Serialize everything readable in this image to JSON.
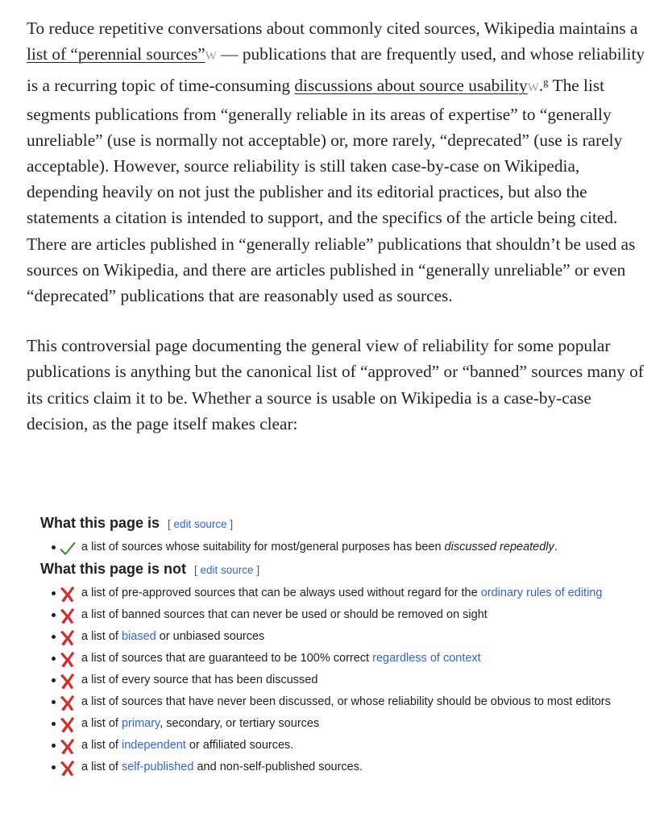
{
  "article": {
    "p1": {
      "t1": "To reduce repetitive conversations about commonly cited sources, Wikipedia maintains a ",
      "link1": "list of “perennial sources”",
      "wmark1": "W",
      "t2": " — publications that are frequently used, and whose reliability is a recurring topic of time-consuming ",
      "link2": "discussions about source usability",
      "wmark2": "W",
      "t3": ".",
      "sup": "g",
      "t4": " The list segments publications from “generally reliable in its areas of expertise” to “generally unreliable” (use is normally not acceptable) or, more rarely, “deprecated” (use is rarely acceptable). However, source reliability is still taken case-by-case on Wikipedia, depending heavily on not just the publisher and its editorial practices, but also the statements a citation is intended to support, and the specifics of the article being cited. There are articles published in “generally reliable” publications that shouldn’t be used as sources on Wikipedia, and there are articles published in “generally unreliable” or even “deprecated” publications that are reasonably used as sources."
    },
    "p2": "This controversial page documenting the general view of reliability for some popular publications is anything but the canonical list of “approved” or “banned” sources many of its critics claim it to be. Whether a source is usable on Wikipedia is a case-by-case decision, as the page itself makes clear:"
  },
  "wiki_excerpt": {
    "section_is": {
      "heading": "What this page is",
      "edit_open": "[ ",
      "edit_label": "edit source",
      "edit_close": " ]",
      "items": [
        {
          "icon": "check-icon",
          "pre": "a list of sources whose suitability for most/general purposes has been ",
          "italic": "discussed repeatedly",
          "post": "."
        }
      ]
    },
    "section_is_not": {
      "heading": "What this page is not",
      "edit_open": "[ ",
      "edit_label": "edit source",
      "edit_close": " ]",
      "items": [
        {
          "icon": "x-icon",
          "pre": "a list of pre-approved sources that can be always used without regard for the ",
          "link": "ordinary rules of editing",
          "post": ""
        },
        {
          "icon": "x-icon",
          "pre": "a list of banned sources that can never be used or should be removed on sight",
          "link": "",
          "post": ""
        },
        {
          "icon": "x-icon",
          "pre": "a list of ",
          "link": "biased",
          "post": " or unbiased sources"
        },
        {
          "icon": "x-icon",
          "pre": "a list of sources that are guaranteed to be 100% correct ",
          "link": "regardless of context",
          "post": ""
        },
        {
          "icon": "x-icon",
          "pre": "a list of every source that has been discussed",
          "link": "",
          "post": ""
        },
        {
          "icon": "x-icon",
          "pre": "a list of sources that have never been discussed, or whose reliability should be obvious to most editors",
          "link": "",
          "post": ""
        },
        {
          "icon": "x-icon",
          "pre": "a list of ",
          "link": "primary",
          "post": ", secondary, or tertiary sources"
        },
        {
          "icon": "x-icon",
          "pre": "a list of ",
          "link": "independent",
          "post": " or affiliated sources."
        },
        {
          "icon": "x-icon",
          "pre": "a list of ",
          "link": "self-published",
          "post": " and non-self-published sources."
        }
      ]
    },
    "colors": {
      "link": "#3366cc",
      "check": "#1f8a1f",
      "cross": "#d22e2e"
    }
  }
}
